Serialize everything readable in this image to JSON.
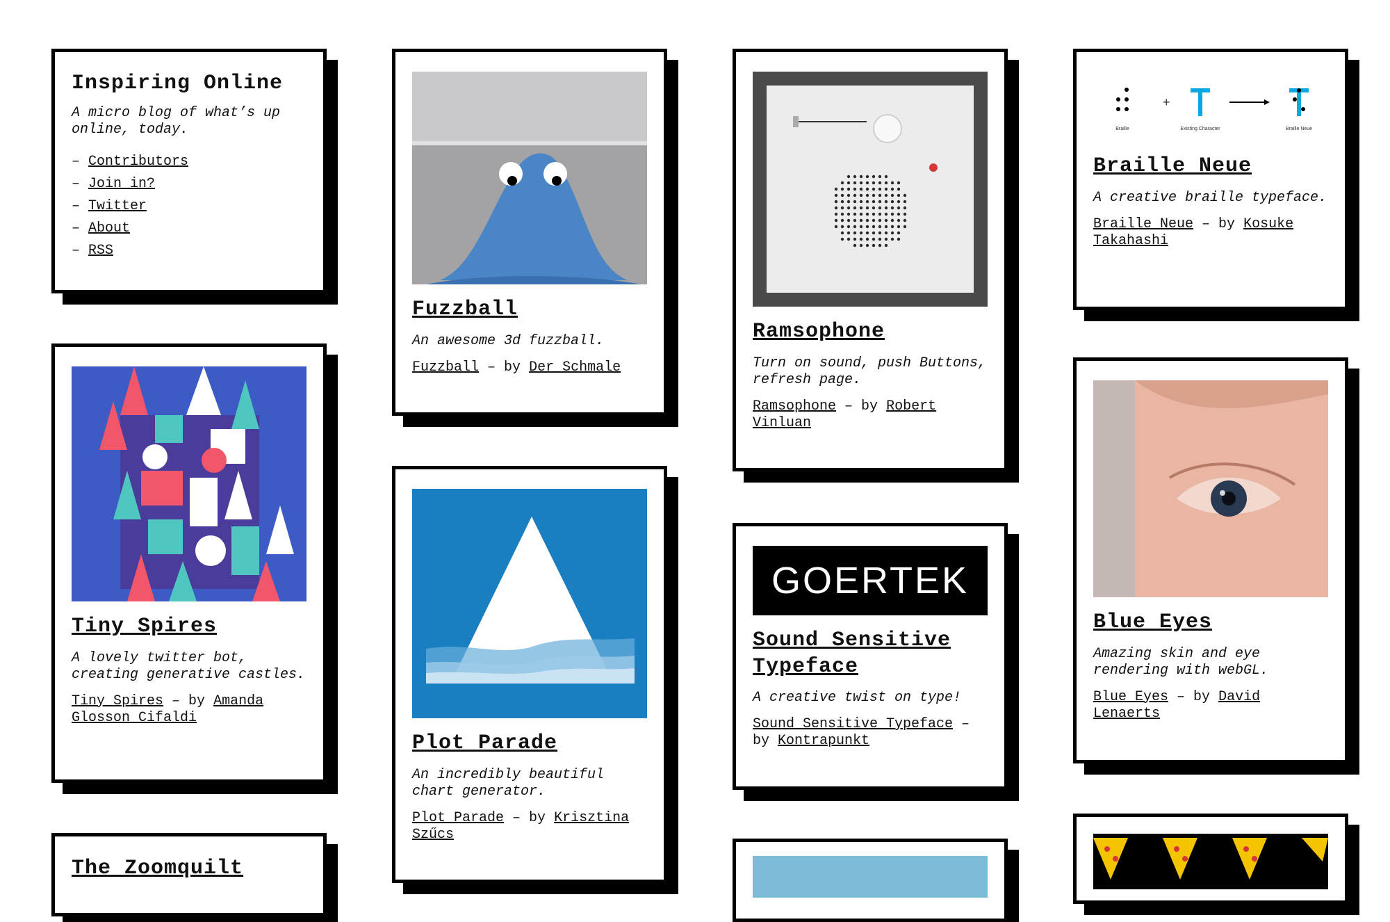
{
  "intro": {
    "title": "Inspiring Online",
    "tagline": "A micro blog of what’s up online, today.",
    "nav": [
      "Contributors",
      "Join in?",
      "Twitter",
      "About",
      "RSS"
    ]
  },
  "posts": {
    "fuzzball": {
      "title": "Fuzzball",
      "desc": "An awesome 3d fuzzball.",
      "link": "Fuzzball",
      "by": "by",
      "author": "Der Schmale"
    },
    "ramsophone": {
      "title": "Ramsophone",
      "desc": "Turn on sound, push Buttons, refresh page.",
      "link": "Ramsophone",
      "by": "by",
      "author": "Robert Vinluan"
    },
    "braille": {
      "title": "Braille Neue",
      "desc": "A creative braille typeface.",
      "link": "Braille Neue",
      "by": "by",
      "author": "Kosuke Takahashi",
      "thumb_labels": {
        "braille": "Braille",
        "existing": "Existing Character",
        "neue": "Braille Neue"
      }
    },
    "tiny_spires": {
      "title": "Tiny Spires",
      "desc": "A lovely twitter bot, creating generative castles.",
      "link": "Tiny Spires",
      "by": "by",
      "author": "Amanda Glosson Cifaldi"
    },
    "plot_parade": {
      "title": "Plot Parade",
      "desc": "An incredibly beautiful chart generator.",
      "link": "Plot Parade",
      "by": "by",
      "author": "Krisztina Szűcs"
    },
    "sound_typeface": {
      "title": "Sound Sensitive Typeface",
      "desc": "A creative twist on type!",
      "link": "Sound Sensitive Typeface",
      "by": "by",
      "author": "Kontrapunkt",
      "thumb_word": "GOERTEK"
    },
    "blue_eyes": {
      "title": "Blue Eyes",
      "desc": "Amazing skin and eye rendering with webGL.",
      "link": "Blue Eyes",
      "by": "by",
      "author": "David Lenaerts"
    },
    "zoomquilt": {
      "title": "The Zoomquilt"
    }
  },
  "colors": {
    "accent_blue": "#1a7fc0",
    "castle_bg": "#3d5bc4",
    "sky": "#7ebbd8"
  }
}
